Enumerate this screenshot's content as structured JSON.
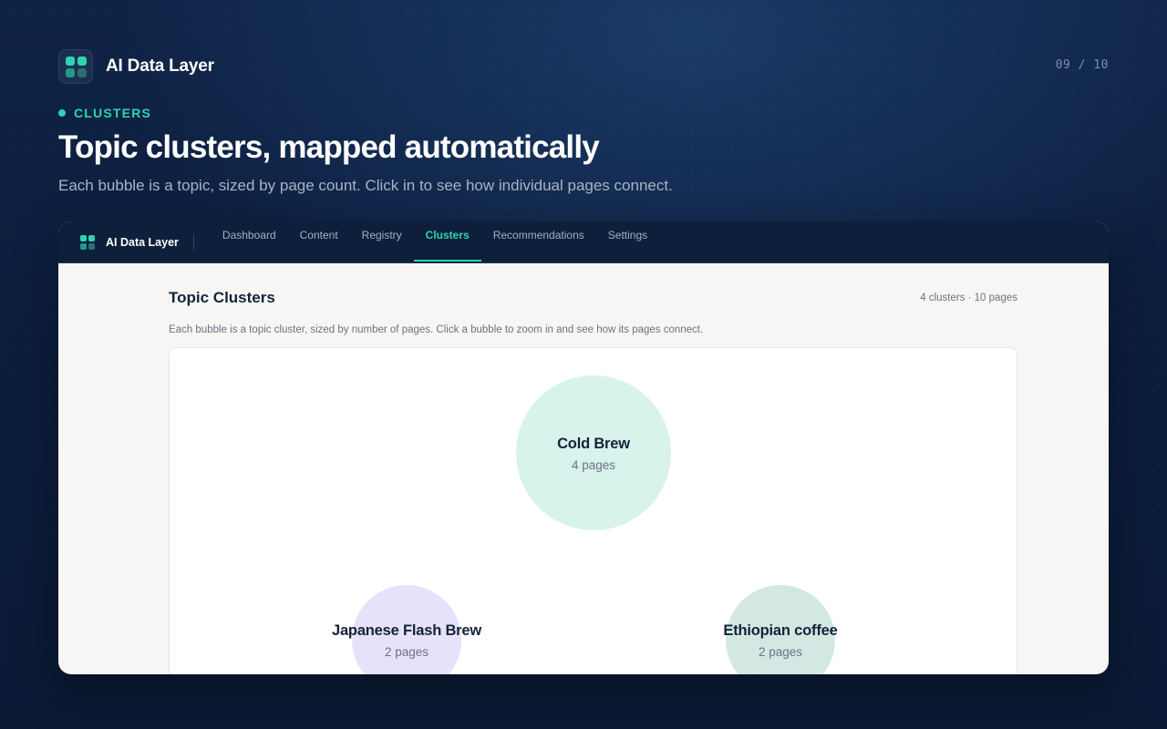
{
  "slide": {
    "brand_name": "AI Data Layer",
    "pager": "09 / 10",
    "eyebrow": "CLUSTERS",
    "headline": "Topic clusters, mapped automatically",
    "subline": "Each bubble is a topic, sized by page count. Click in to see how individual pages connect."
  },
  "app": {
    "name": "AI Data Layer",
    "nav": [
      {
        "label": "Dashboard"
      },
      {
        "label": "Content"
      },
      {
        "label": "Registry"
      },
      {
        "label": "Clusters",
        "active": true
      },
      {
        "label": "Recommendations"
      },
      {
        "label": "Settings"
      }
    ],
    "page_title": "Topic Clusters",
    "stats": "4 clusters · 10 pages",
    "description": "Each bubble is a topic cluster, sized by number of pages. Click a bubble to zoom in and see how its pages connect.",
    "clusters": [
      {
        "name": "Cold Brew",
        "count_label": "4 pages",
        "pages": 4,
        "color": "#d7f3ec"
      },
      {
        "name": "Japanese Flash Brew",
        "count_label": "2 pages",
        "pages": 2,
        "color": "#e7e1fb"
      },
      {
        "name": "Ethiopian coffee",
        "count_label": "2 pages",
        "pages": 2,
        "color": "#d3e8e3"
      }
    ]
  },
  "colors": {
    "accent": "#2dd4b0",
    "background": "#0c1d3c",
    "app_bar": "#0e1f3c",
    "panel": "#f7f6f4"
  },
  "icons": {
    "brand_logo": "grid-logo-icon"
  }
}
